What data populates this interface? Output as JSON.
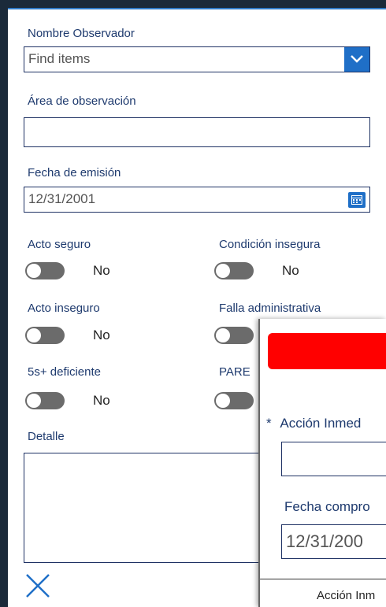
{
  "form": {
    "observer_label": "Nombre Observador",
    "observer_placeholder": "Find items",
    "area_label": "Área de observación",
    "area_value": "",
    "date_label": "Fecha de emisión",
    "date_value": "12/31/2001",
    "toggles": [
      {
        "label": "Acto seguro",
        "value": "No"
      },
      {
        "label": "Condición insegura",
        "value": "No"
      },
      {
        "label": "Acto inseguro",
        "value": "No"
      },
      {
        "label": "Falla administrativa",
        "value": ""
      },
      {
        "label": "5s+ deficiente",
        "value": "No"
      },
      {
        "label": "PARE",
        "value": ""
      }
    ],
    "detail_label": "Detalle",
    "detail_value": ""
  },
  "dialog": {
    "required_mark": "*",
    "accion_label": "Acción Inmed",
    "accion_value": "",
    "fecha_label": "Fecha compro",
    "fecha_value": "12/31/200",
    "footer_label": "Acción Inm"
  },
  "colors": {
    "accent": "#1f6fc7",
    "label": "#1e3a6e",
    "alert": "#ff0000",
    "toggle_off": "#6b6b6b",
    "backdrop": "#1b2a3a"
  },
  "icons": {
    "dropdown": "chevron-down-icon",
    "calendar": "calendar-icon",
    "close": "close-icon"
  }
}
